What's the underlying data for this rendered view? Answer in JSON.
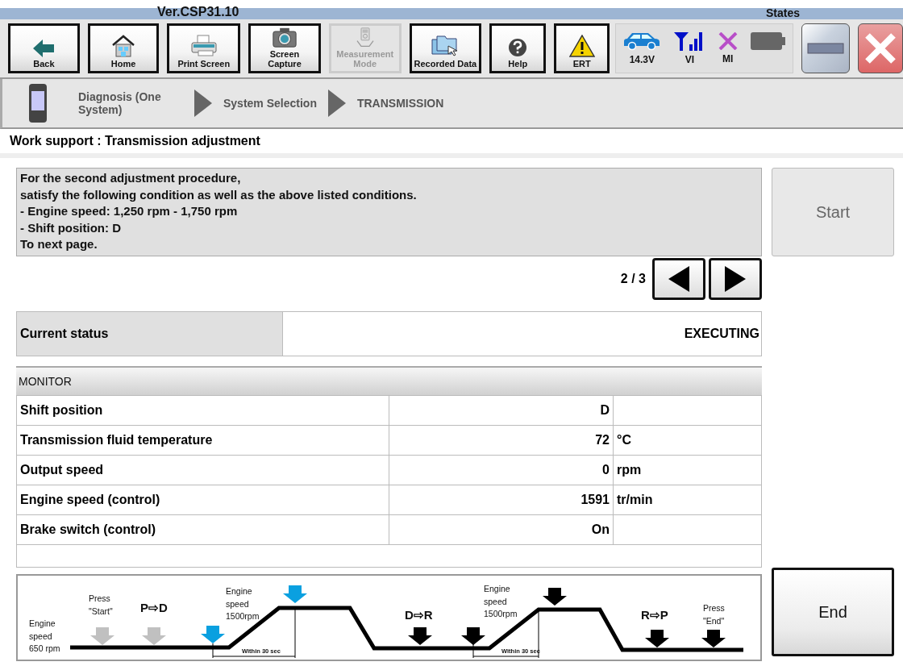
{
  "header": {
    "version": "Ver.CSP31.10",
    "states_label": "States"
  },
  "toolbar": [
    {
      "label": "Back",
      "disabled": false
    },
    {
      "label": "Home",
      "disabled": false
    },
    {
      "label": "Print Screen",
      "disabled": false
    },
    {
      "label": "Screen Capture",
      "disabled": false
    },
    {
      "label": "Measurement Mode",
      "disabled": true
    },
    {
      "label": "Recorded Data",
      "disabled": false
    },
    {
      "label": "Help",
      "disabled": false
    },
    {
      "label": "ERT",
      "disabled": false
    }
  ],
  "status_indicators": [
    {
      "kind": "car",
      "label": "14.3V"
    },
    {
      "kind": "vi",
      "label": "VI"
    },
    {
      "kind": "mi",
      "label": "MI"
    },
    {
      "kind": "battery"
    }
  ],
  "breadcrumb": [
    "Diagnosis (One System)",
    "System Selection",
    "TRANSMISSION"
  ],
  "page_title": "Work support : Transmission adjustment",
  "instructions": [
    "For the second adjustment procedure,",
    "satisfy the following condition as well as the above listed conditions.",
    "- Engine speed: 1,250 rpm - 1,750 rpm",
    "- Shift position: D",
    "To next page."
  ],
  "start_button": {
    "label": "Start",
    "disabled": true
  },
  "pager": {
    "text": "2 / 3"
  },
  "current_status": {
    "label": "Current status",
    "value": "EXECUTING"
  },
  "monitor": {
    "title": "MONITOR",
    "rows": [
      {
        "item": "Shift position",
        "value": "D",
        "unit": ""
      },
      {
        "item": "Transmission fluid temperature",
        "value": "72",
        "unit": "°C"
      },
      {
        "item": "Output speed",
        "value": "0",
        "unit": "rpm"
      },
      {
        "item": "Engine speed (control)",
        "value": "1591",
        "unit": "tr/min"
      },
      {
        "item": "Brake switch (control)",
        "value": "On",
        "unit": ""
      }
    ]
  },
  "diagram_labels": [
    {
      "kind": "note",
      "lines": [
        "Engine",
        "speed",
        "650 rpm"
      ]
    },
    {
      "kind": "note",
      "lines": [
        "Press",
        "\"Start\""
      ]
    },
    {
      "kind": "shift",
      "lines": [
        "P⇨D"
      ]
    },
    {
      "kind": "note",
      "lines": [
        "Engine",
        "speed",
        "1500rpm"
      ]
    },
    {
      "kind": "timing",
      "lines": [
        "Within 30 sec"
      ]
    },
    {
      "kind": "shift",
      "lines": [
        "D⇨R"
      ]
    },
    {
      "kind": "note",
      "lines": [
        "Engine",
        "speed",
        "1500rpm"
      ]
    },
    {
      "kind": "timing",
      "lines": [
        "Within 30 sec"
      ]
    },
    {
      "kind": "shift",
      "lines": [
        "R⇨P"
      ]
    },
    {
      "kind": "note",
      "lines": [
        "Press",
        "\"End\""
      ]
    }
  ],
  "end_button": {
    "label": "End"
  }
}
